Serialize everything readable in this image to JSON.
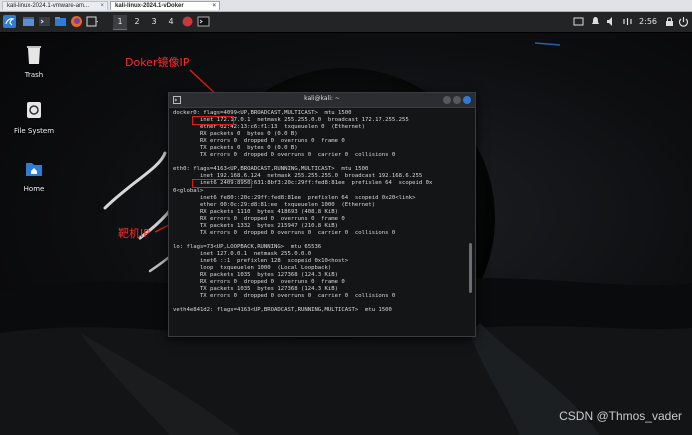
{
  "host_tabs": {
    "tab1": "kali-linux-2024.1-vmware-am...",
    "tab2": "kali-linux-2024.1-vDoker",
    "close": "×"
  },
  "panel": {
    "workspaces": [
      "1",
      "2",
      "3",
      "4"
    ],
    "clock": "2:56"
  },
  "desktop_icons": [
    {
      "label": "Trash"
    },
    {
      "label": "File System"
    },
    {
      "label": "Home"
    }
  ],
  "annotations": {
    "docker_ip": "Doker镜像IP",
    "host_ip": "靶机IP"
  },
  "terminal": {
    "title": "kali@kali: ~",
    "lines": [
      "docker0: flags=4099<UP,BROADCAST,MULTICAST>  mtu 1500",
      "        inet 172.17.0.1  netmask 255.255.0.0  broadcast 172.17.255.255",
      "        ether 02:42:13:c6:f1:13  txqueuelen 0  (Ethernet)",
      "        RX packets 0  bytes 0 (0.0 B)",
      "        RX errors 0  dropped 0  overruns 0  frame 0",
      "        TX packets 0  bytes 0 (0.0 B)",
      "        TX errors 0  dropped 0 overruns 0  carrier 0  collisions 0",
      "",
      "eth0: flags=4163<UP,BROADCAST,RUNNING,MULTICAST>  mtu 1500",
      "        inet 192.168.6.124  netmask 255.255.255.0  broadcast 192.168.6.255",
      "        inet6 2409:8950:631:8bf3:20c:29ff:fed8:81ee  prefixlen 64  scopeid 0x",
      "0<global>",
      "        inet6 fe80::20c:29ff:fed8:81ee  prefixlen 64  scopeid 0x20<link>",
      "        ether 00:0c:29:d8:81:ee  txqueuelen 1000  (Ethernet)",
      "        RX packets 1110  bytes 418693 (408.8 KiB)",
      "        RX errors 0  dropped 0  overruns 0  frame 0",
      "        TX packets 1332  bytes 215947 (210.8 KiB)",
      "        TX errors 0  dropped 0 overruns 0  carrier 0  collisions 0",
      "",
      "lo: flags=73<UP,LOOPBACK,RUNNING>  mtu 65536",
      "        inet 127.0.0.1  netmask 255.0.0.0",
      "        inet6 ::1  prefixlen 128  scopeid 0x10<host>",
      "        loop  txqueuelen 1000  (Local Loopback)",
      "        RX packets 1035  bytes 127368 (124.3 KiB)",
      "        RX errors 0  dropped 0  overruns 0  frame 0",
      "        TX packets 1035  bytes 127368 (124.3 KiB)",
      "        TX errors 0  dropped 0 overruns 0  carrier 0  collisions 0",
      "",
      "veth4e841d2: flags=4163<UP,BROADCAST,RUNNING,MULTICAST>  mtu 1500"
    ]
  },
  "watermark": "CSDN @Thmos_vader",
  "colors": {
    "annotation": "#ff2a2a",
    "panel": "#222426",
    "accent": "#2f7cd6"
  }
}
